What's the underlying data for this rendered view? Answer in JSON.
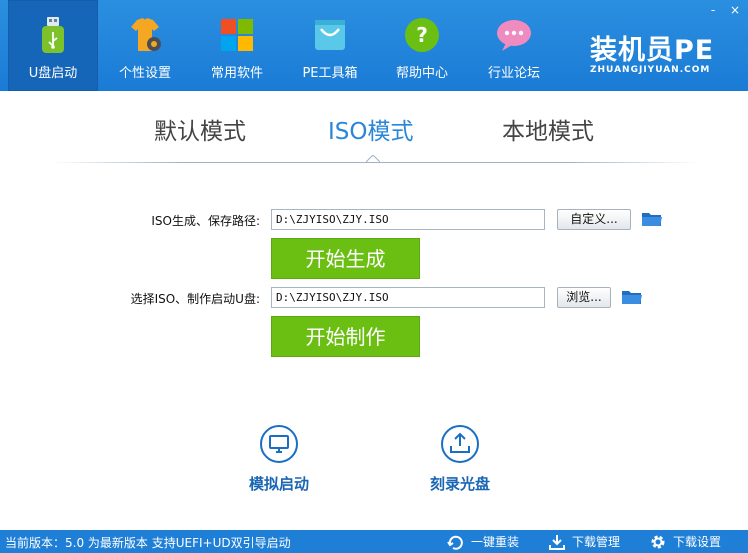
{
  "header": {
    "nav": [
      {
        "label": "U盘启动",
        "icon": "usb-drive-icon",
        "active": true
      },
      {
        "label": "个性设置",
        "icon": "tshirt-gear-icon",
        "active": false
      },
      {
        "label": "常用软件",
        "icon": "windows-tiles-icon",
        "active": false
      },
      {
        "label": "PE工具箱",
        "icon": "shopping-bag-icon",
        "active": false
      },
      {
        "label": "帮助中心",
        "icon": "question-icon",
        "active": false
      },
      {
        "label": "行业论坛",
        "icon": "chat-bubble-icon",
        "active": false
      }
    ],
    "window_controls": {
      "minimize": "-",
      "close": "×"
    },
    "brand": {
      "title": "装机员PE",
      "subtitle": "ZHUANGJIYUAN.COM"
    }
  },
  "tabs": [
    {
      "label": "默认模式",
      "active": false
    },
    {
      "label": "ISO模式",
      "active": true
    },
    {
      "label": "本地模式",
      "active": false
    }
  ],
  "form": {
    "row1": {
      "label": "ISO生成、保存路径:",
      "value": "D:\\ZJYISO\\ZJY.ISO",
      "button": "自定义...",
      "action": "开始生成"
    },
    "row2": {
      "label": "选择ISO、制作启动U盘:",
      "value": "D:\\ZJYISO\\ZJY.ISO",
      "button": "浏览...",
      "action": "开始制作"
    }
  },
  "actions": [
    {
      "label": "模拟启动",
      "icon": "monitor-icon"
    },
    {
      "label": "刻录光盘",
      "icon": "upload-tray-icon"
    }
  ],
  "status": {
    "text": "当前版本：5.0 为最新版本 支持UEFI+UD双引导启动",
    "links": [
      {
        "label": "一键重装",
        "icon": "refresh-icon"
      },
      {
        "label": "下载管理",
        "icon": "download-icon"
      },
      {
        "label": "下载设置",
        "icon": "gear-icon"
      }
    ]
  },
  "colors": {
    "header_blue": "#1a7bd5",
    "active_nav": "#1565b8",
    "accent_green": "#6bbf12",
    "tab_active": "#2a86d8"
  }
}
